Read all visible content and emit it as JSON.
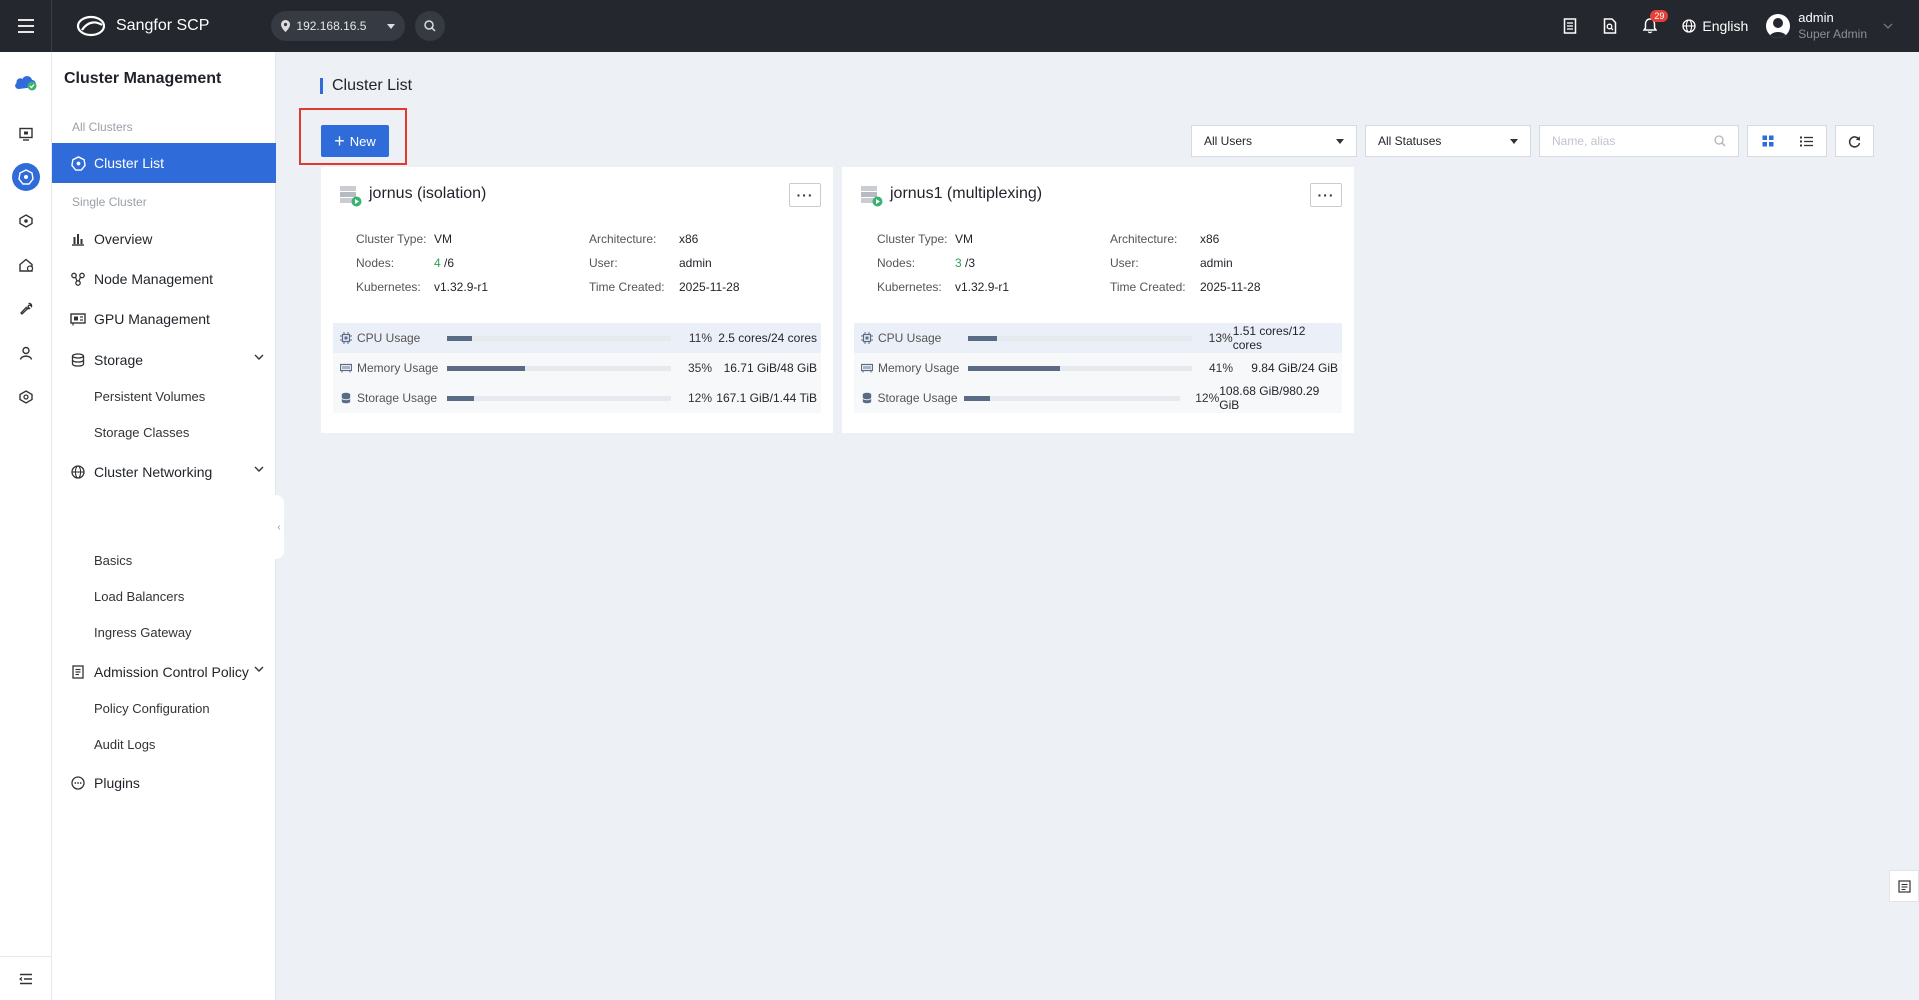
{
  "topbar": {
    "brand": "Sangfor SCP",
    "ip": "192.168.16.5",
    "notif_count": "29",
    "language": "English",
    "user_name": "admin",
    "user_role": "Super Admin"
  },
  "sidebar": {
    "title": "Cluster Management",
    "group_all": "All Clusters",
    "cluster_list": "Cluster List",
    "group_single": "Single Cluster",
    "overview": "Overview",
    "node_mgmt": "Node Management",
    "gpu_mgmt": "GPU Management",
    "storage": "Storage",
    "storage_sub": [
      "Persistent Volumes",
      "Storage Classes"
    ],
    "networking": "Cluster Networking",
    "networking_sub": [
      "Basics",
      "Load Balancers",
      "Ingress Gateway"
    ],
    "admission": "Admission Control Policy",
    "admission_sub": [
      "Policy Configuration",
      "Audit Logs"
    ],
    "plugins": "Plugins"
  },
  "main": {
    "page_title": "Cluster List",
    "new_label": "New",
    "filter_users": "All Users",
    "filter_statuses": "All Statuses",
    "search_placeholder": "Name, alias"
  },
  "labels": {
    "cluster_type": "Cluster Type:",
    "architecture": "Architecture:",
    "nodes": "Nodes:",
    "user": "User:",
    "kubernetes": "Kubernetes:",
    "time_created": "Time Created:",
    "cpu": "CPU Usage",
    "memory": "Memory Usage",
    "storage": "Storage Usage"
  },
  "clusters": [
    {
      "name": "jornus (isolation)",
      "cluster_type": "VM",
      "architecture": "x86",
      "nodes_ready": "4",
      "nodes_total": "/6",
      "user": "admin",
      "kubernetes": "v1.32.9-r1",
      "time_created": "2025-11-28",
      "cpu_pct": "11%",
      "cpu_amount": "2.5 cores/24 cores",
      "cpu_fraction": 0.11,
      "mem_pct": "35%",
      "mem_amount": "16.71 GiB/48 GiB",
      "mem_fraction": 0.35,
      "sto_pct": "12%",
      "sto_amount": "167.1 GiB/1.44 TiB",
      "sto_fraction": 0.12
    },
    {
      "name": "jornus1 (multiplexing)",
      "cluster_type": "VM",
      "architecture": "x86",
      "nodes_ready": "3",
      "nodes_total": "/3",
      "user": "admin",
      "kubernetes": "v1.32.9-r1",
      "time_created": "2025-11-28",
      "cpu_pct": "13%",
      "cpu_amount": "1.51 cores/12 cores",
      "cpu_fraction": 0.13,
      "mem_pct": "41%",
      "mem_amount": "9.84 GiB/24 GiB",
      "mem_fraction": 0.41,
      "sto_pct": "12%",
      "sto_amount": "108.68 GiB/980.29 GiB",
      "sto_fraction": 0.12
    }
  ],
  "colors": {
    "accent": "#2f6bd9",
    "topbar": "#24272e",
    "highlight": "#e0392d",
    "ready_nodes": "#2aa44f"
  }
}
